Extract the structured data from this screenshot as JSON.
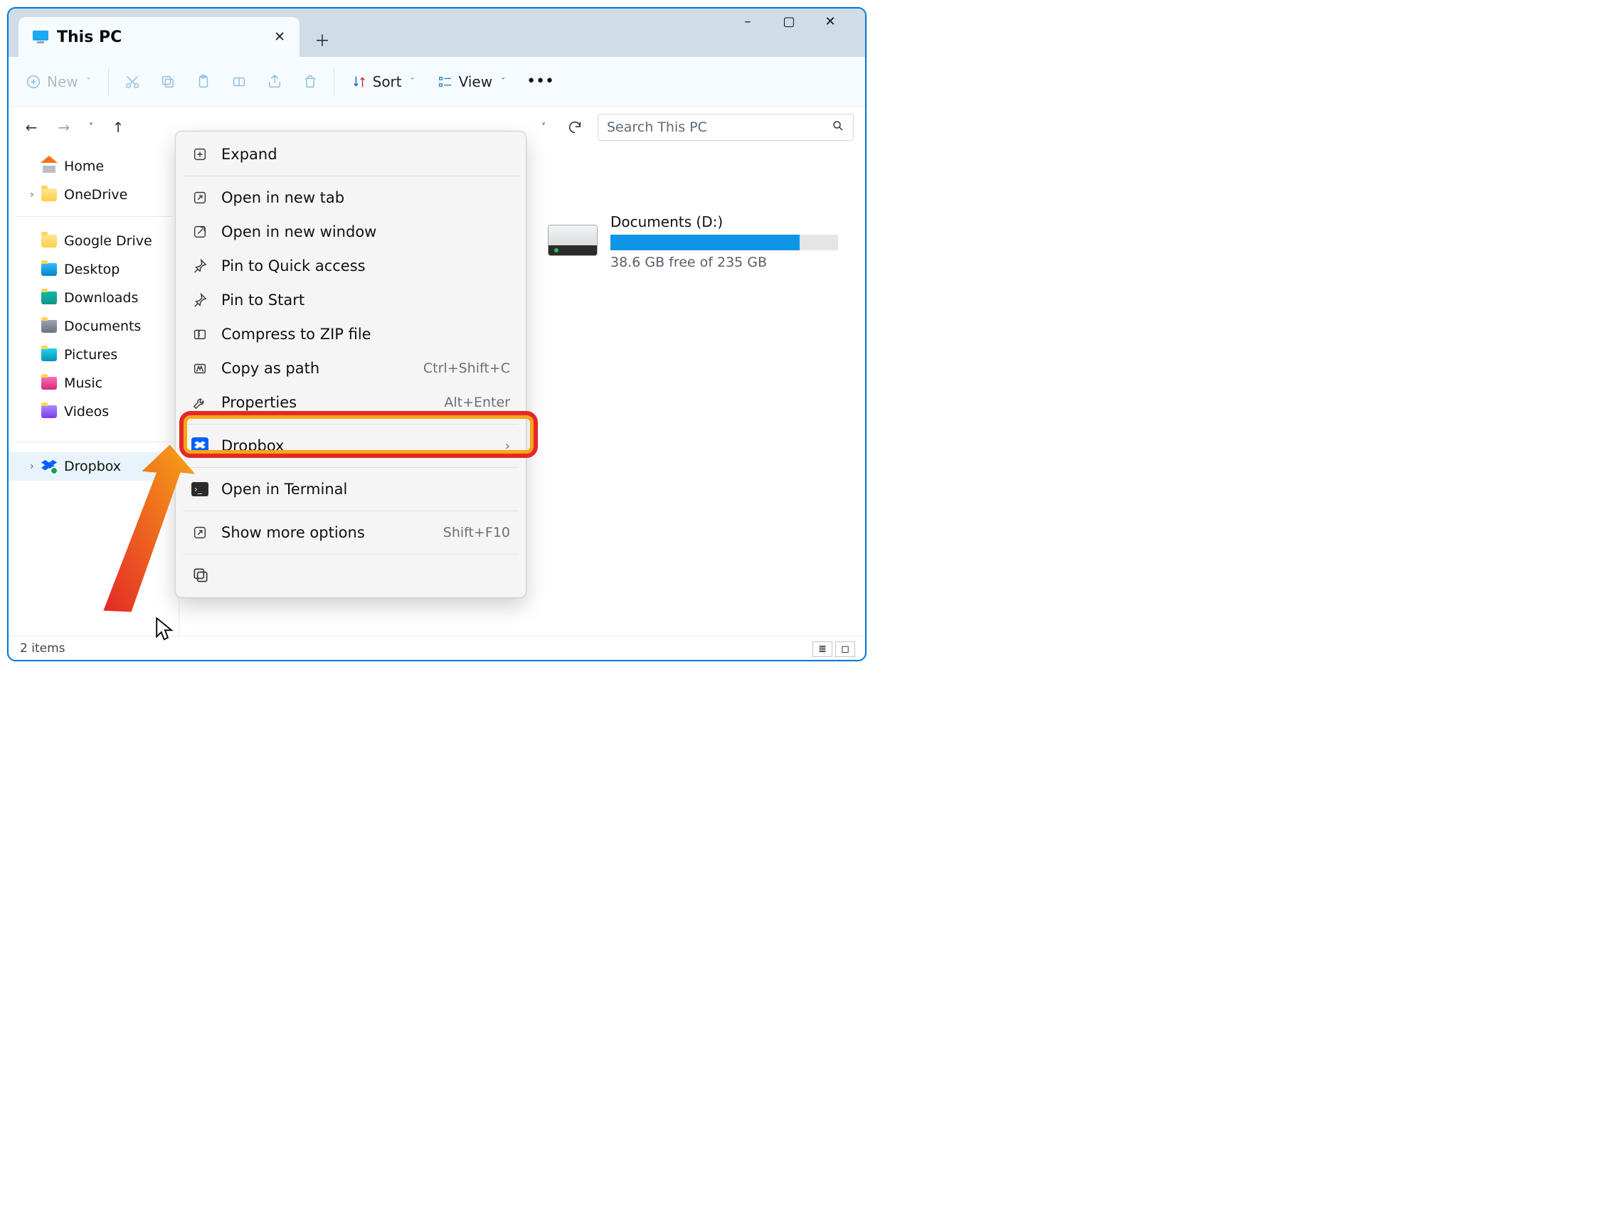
{
  "window": {
    "tab_title": "This PC",
    "controls": {
      "minimize": "–",
      "maximize": "▢",
      "close": "✕"
    }
  },
  "toolbar": {
    "new": "New",
    "sort": "Sort",
    "view": "View"
  },
  "search": {
    "placeholder": "Search This PC"
  },
  "sidebar": {
    "home": "Home",
    "onedrive": "OneDrive",
    "group2": [
      "Google Drive",
      "Desktop",
      "Downloads",
      "Documents",
      "Pictures",
      "Music",
      "Videos"
    ],
    "dropbox": "Dropbox"
  },
  "context_menu": {
    "items": [
      {
        "label": "Expand"
      },
      {
        "label": "Open in new tab"
      },
      {
        "label": "Open in new window"
      },
      {
        "label": "Pin to Quick access"
      },
      {
        "label": "Pin to Start"
      },
      {
        "label": "Compress to ZIP file"
      },
      {
        "label": "Copy as path",
        "shortcut": "Ctrl+Shift+C"
      },
      {
        "label": "Properties",
        "shortcut": "Alt+Enter"
      },
      {
        "label": "Dropbox",
        "submenu": true
      },
      {
        "label": "Open in Terminal"
      },
      {
        "label": "Show more options",
        "shortcut": "Shift+F10"
      }
    ]
  },
  "drive": {
    "name": "Documents (D:)",
    "free_text": "38.6 GB free of 235 GB",
    "fill_percent": 83
  },
  "statusbar": {
    "count": "2 items"
  },
  "colors": {
    "accent": "#0179d8",
    "bar_fill": "#0f95e8"
  }
}
